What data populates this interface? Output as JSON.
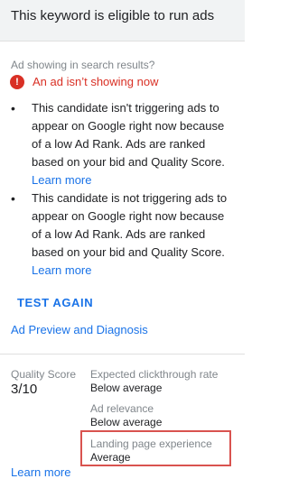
{
  "header": {
    "title": "This keyword is eligible to run ads"
  },
  "status": {
    "label": "Ad showing in search results?",
    "icon": "error-icon",
    "icon_glyph": "!",
    "text": "An ad isn’t showing now",
    "color": "#d93025"
  },
  "reasons": [
    {
      "text": "This candidate isn't triggering ads to appear on Google right now because of a low Ad Rank. Ads are ranked based on your bid and Quality Score.",
      "link": "Learn more"
    },
    {
      "text": "This candidate is not triggering ads to appear on Google right now because of a low Ad Rank. Ads are ranked based on your bid and Quality Score.",
      "link": "Learn more"
    }
  ],
  "actions": {
    "test_again": "TEST AGAIN",
    "preview": "Ad Preview and Diagnosis"
  },
  "quality_score": {
    "label": "Quality Score",
    "value": "3/10",
    "metrics": [
      {
        "label": "Expected clickthrough rate",
        "value": "Below average"
      },
      {
        "label": "Ad relevance",
        "value": "Below average"
      },
      {
        "label": "Landing page experience",
        "value": "Average",
        "highlighted": true
      }
    ]
  },
  "footer": {
    "learn_more": "Learn more"
  },
  "colors": {
    "link": "#1a73e8",
    "error": "#d93025",
    "highlight": "#d9534f"
  }
}
